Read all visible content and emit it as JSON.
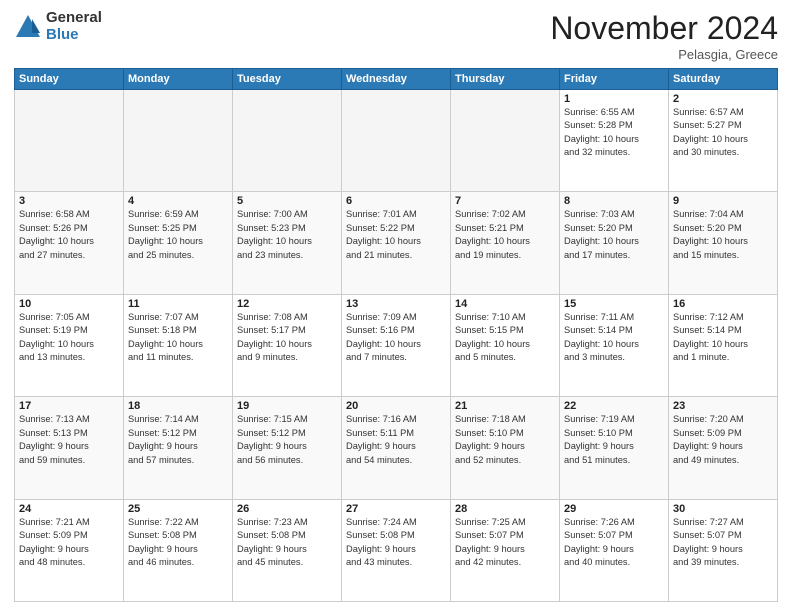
{
  "logo": {
    "general": "General",
    "blue": "Blue"
  },
  "header": {
    "month": "November 2024",
    "location": "Pelasgia, Greece"
  },
  "weekdays": [
    "Sunday",
    "Monday",
    "Tuesday",
    "Wednesday",
    "Thursday",
    "Friday",
    "Saturday"
  ],
  "weeks": [
    [
      {
        "day": "",
        "info": ""
      },
      {
        "day": "",
        "info": ""
      },
      {
        "day": "",
        "info": ""
      },
      {
        "day": "",
        "info": ""
      },
      {
        "day": "",
        "info": ""
      },
      {
        "day": "1",
        "info": "Sunrise: 6:55 AM\nSunset: 5:28 PM\nDaylight: 10 hours\nand 32 minutes."
      },
      {
        "day": "2",
        "info": "Sunrise: 6:57 AM\nSunset: 5:27 PM\nDaylight: 10 hours\nand 30 minutes."
      }
    ],
    [
      {
        "day": "3",
        "info": "Sunrise: 6:58 AM\nSunset: 5:26 PM\nDaylight: 10 hours\nand 27 minutes."
      },
      {
        "day": "4",
        "info": "Sunrise: 6:59 AM\nSunset: 5:25 PM\nDaylight: 10 hours\nand 25 minutes."
      },
      {
        "day": "5",
        "info": "Sunrise: 7:00 AM\nSunset: 5:23 PM\nDaylight: 10 hours\nand 23 minutes."
      },
      {
        "day": "6",
        "info": "Sunrise: 7:01 AM\nSunset: 5:22 PM\nDaylight: 10 hours\nand 21 minutes."
      },
      {
        "day": "7",
        "info": "Sunrise: 7:02 AM\nSunset: 5:21 PM\nDaylight: 10 hours\nand 19 minutes."
      },
      {
        "day": "8",
        "info": "Sunrise: 7:03 AM\nSunset: 5:20 PM\nDaylight: 10 hours\nand 17 minutes."
      },
      {
        "day": "9",
        "info": "Sunrise: 7:04 AM\nSunset: 5:20 PM\nDaylight: 10 hours\nand 15 minutes."
      }
    ],
    [
      {
        "day": "10",
        "info": "Sunrise: 7:05 AM\nSunset: 5:19 PM\nDaylight: 10 hours\nand 13 minutes."
      },
      {
        "day": "11",
        "info": "Sunrise: 7:07 AM\nSunset: 5:18 PM\nDaylight: 10 hours\nand 11 minutes."
      },
      {
        "day": "12",
        "info": "Sunrise: 7:08 AM\nSunset: 5:17 PM\nDaylight: 10 hours\nand 9 minutes."
      },
      {
        "day": "13",
        "info": "Sunrise: 7:09 AM\nSunset: 5:16 PM\nDaylight: 10 hours\nand 7 minutes."
      },
      {
        "day": "14",
        "info": "Sunrise: 7:10 AM\nSunset: 5:15 PM\nDaylight: 10 hours\nand 5 minutes."
      },
      {
        "day": "15",
        "info": "Sunrise: 7:11 AM\nSunset: 5:14 PM\nDaylight: 10 hours\nand 3 minutes."
      },
      {
        "day": "16",
        "info": "Sunrise: 7:12 AM\nSunset: 5:14 PM\nDaylight: 10 hours\nand 1 minute."
      }
    ],
    [
      {
        "day": "17",
        "info": "Sunrise: 7:13 AM\nSunset: 5:13 PM\nDaylight: 9 hours\nand 59 minutes."
      },
      {
        "day": "18",
        "info": "Sunrise: 7:14 AM\nSunset: 5:12 PM\nDaylight: 9 hours\nand 57 minutes."
      },
      {
        "day": "19",
        "info": "Sunrise: 7:15 AM\nSunset: 5:12 PM\nDaylight: 9 hours\nand 56 minutes."
      },
      {
        "day": "20",
        "info": "Sunrise: 7:16 AM\nSunset: 5:11 PM\nDaylight: 9 hours\nand 54 minutes."
      },
      {
        "day": "21",
        "info": "Sunrise: 7:18 AM\nSunset: 5:10 PM\nDaylight: 9 hours\nand 52 minutes."
      },
      {
        "day": "22",
        "info": "Sunrise: 7:19 AM\nSunset: 5:10 PM\nDaylight: 9 hours\nand 51 minutes."
      },
      {
        "day": "23",
        "info": "Sunrise: 7:20 AM\nSunset: 5:09 PM\nDaylight: 9 hours\nand 49 minutes."
      }
    ],
    [
      {
        "day": "24",
        "info": "Sunrise: 7:21 AM\nSunset: 5:09 PM\nDaylight: 9 hours\nand 48 minutes."
      },
      {
        "day": "25",
        "info": "Sunrise: 7:22 AM\nSunset: 5:08 PM\nDaylight: 9 hours\nand 46 minutes."
      },
      {
        "day": "26",
        "info": "Sunrise: 7:23 AM\nSunset: 5:08 PM\nDaylight: 9 hours\nand 45 minutes."
      },
      {
        "day": "27",
        "info": "Sunrise: 7:24 AM\nSunset: 5:08 PM\nDaylight: 9 hours\nand 43 minutes."
      },
      {
        "day": "28",
        "info": "Sunrise: 7:25 AM\nSunset: 5:07 PM\nDaylight: 9 hours\nand 42 minutes."
      },
      {
        "day": "29",
        "info": "Sunrise: 7:26 AM\nSunset: 5:07 PM\nDaylight: 9 hours\nand 40 minutes."
      },
      {
        "day": "30",
        "info": "Sunrise: 7:27 AM\nSunset: 5:07 PM\nDaylight: 9 hours\nand 39 minutes."
      }
    ]
  ]
}
